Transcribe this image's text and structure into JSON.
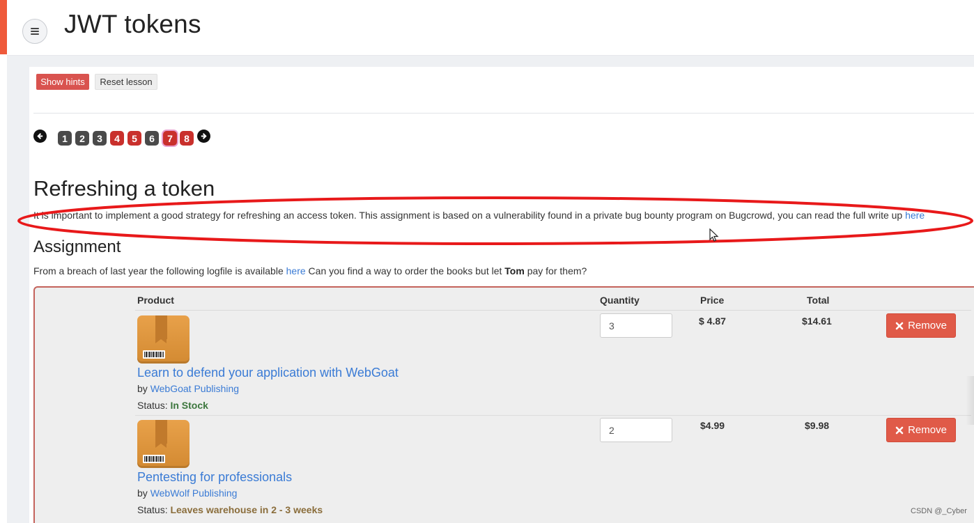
{
  "header": {
    "title": "JWT tokens"
  },
  "toolbar": {
    "show_hints": "Show hints",
    "reset_lesson": "Reset lesson"
  },
  "pagination": {
    "pages": [
      {
        "label": "1",
        "state": "done"
      },
      {
        "label": "2",
        "state": "done"
      },
      {
        "label": "3",
        "state": "done"
      },
      {
        "label": "4",
        "state": "red"
      },
      {
        "label": "5",
        "state": "red"
      },
      {
        "label": "6",
        "state": "done"
      },
      {
        "label": "7",
        "state": "current"
      },
      {
        "label": "8",
        "state": "red"
      }
    ]
  },
  "section": {
    "title": "Refreshing a token",
    "intro": "It is important to implement a good strategy for refreshing an access token. This assignment is based on a vulnerability found in a private bug bounty program on Bugcrowd, you can read the full write up ",
    "intro_link": "here"
  },
  "assignment": {
    "title": "Assignment",
    "text_before": "From a breach of last year the following logfile is available ",
    "link": "here",
    "text_middle": " Can you find a way to order the books but let ",
    "bold_name": "Tom",
    "text_after": " pay for them?"
  },
  "cart": {
    "headers": {
      "product": "Product",
      "quantity": "Quantity",
      "price": "Price",
      "total": "Total"
    },
    "items": [
      {
        "name": "Learn to defend your application with WebGoat",
        "by": "by ",
        "publisher": "WebGoat Publishing",
        "status_label": "Status: ",
        "status": "In Stock",
        "quantity": "3",
        "price": "$ 4.87",
        "total": "$14.61",
        "remove": "Remove"
      },
      {
        "name": "Pentesting for professionals",
        "by": "by ",
        "publisher": "WebWolf Publishing",
        "status_label": "Status: ",
        "status": "Leaves warehouse in 2 - 3 weeks",
        "quantity": "2",
        "price": "$4.99",
        "total": "$9.98",
        "remove": "Remove"
      }
    ]
  },
  "watermark": "CSDN @_Cyber",
  "colors": {
    "accent_red": "#d9534f",
    "link_blue": "#3a7bd5",
    "in_stock_green": "#3c763d",
    "warning_brown": "#8a6d3b",
    "annotation_red": "#e8191a"
  }
}
